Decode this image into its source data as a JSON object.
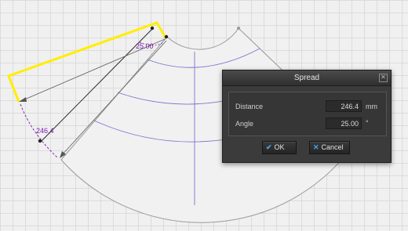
{
  "canvas": {
    "angle_dim_value": "25.00",
    "distance_dim_value": "246.4"
  },
  "dialog": {
    "title": "Spread",
    "close_glyph": "✕",
    "distance": {
      "label": "Distance",
      "value": "246.4",
      "unit": "mm"
    },
    "angle": {
      "label": "Angle",
      "value": "25.00",
      "unit": "°"
    },
    "ok_label": "OK",
    "cancel_label": "Cancel"
  },
  "colors": {
    "selection_highlight": "#ffee00",
    "dimension_text": "#7a19a8",
    "grid_lines": "#7b74cf",
    "dialog_bg": "#3b3b3b",
    "button_icon": "#4aa3e8"
  },
  "icons": [
    "close-icon",
    "check-icon",
    "x-icon"
  ]
}
